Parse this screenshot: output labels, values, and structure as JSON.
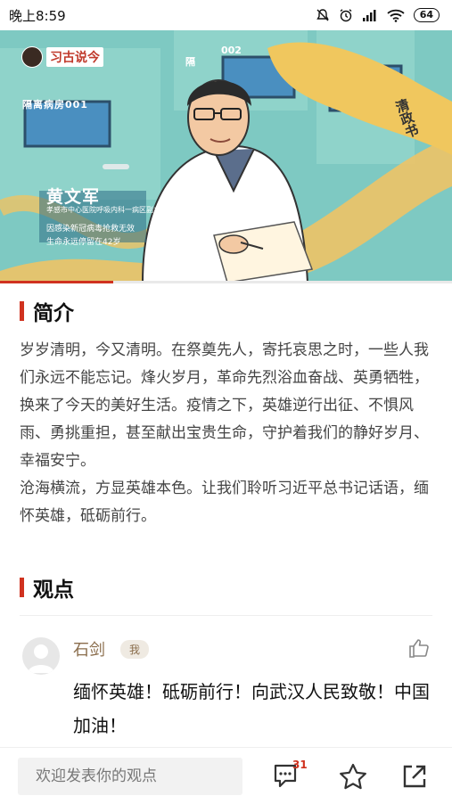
{
  "status_bar": {
    "time": "晚上8:59",
    "battery": "64"
  },
  "hero": {
    "logo_text": "习古说今",
    "room_label_1": "隔离病房001",
    "room_label_2": "002",
    "room_label_3": "隔",
    "banner_text": "清政书",
    "person_name": "黄文军",
    "person_title": "孝感市中心医院呼吸内科一病区副主任医师",
    "caption_line1": "因感染新冠病毒抢救无效",
    "caption_line2": "生命永远停留在42岁",
    "progress": 0.25
  },
  "intro_section": {
    "title": "简介",
    "paragraph1": "岁岁清明，今又清明。在祭奠先人，寄托哀思之时，一些人我们永远不能忘记。烽火岁月，革命先烈浴血奋战、英勇牺牲，换来了今天的美好生活。疫情之下，英雄逆行出征、不惧风雨、勇挑重担，甚至献出宝贵生命，守护着我们的静好岁月、幸福安宁。",
    "paragraph2": "沧海横流，方显英雄本色。让我们聆听习近平总书记话语，缅怀英雄，砥砺前行。"
  },
  "opinion_section": {
    "title": "观点",
    "comment": {
      "author": "石剑",
      "badge": "我",
      "text": "缅怀英雄！砥砺前行！向武汉人民致敬！中国加油！"
    }
  },
  "bottom_bar": {
    "input_placeholder": "欢迎发表你的观点",
    "comment_count": "31"
  },
  "icons": {
    "like": "thumbs-up-icon",
    "comment": "comment-icon",
    "favorite": "star-icon",
    "share": "share-icon"
  },
  "colors": {
    "accent": "#d0321f",
    "author": "#8a6d4c"
  }
}
